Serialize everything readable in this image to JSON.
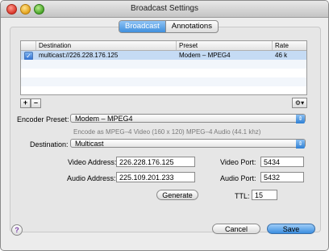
{
  "window": {
    "title": "Broadcast Settings"
  },
  "tabs": [
    {
      "label": "Broadcast",
      "active": true
    },
    {
      "label": "Annotations",
      "active": false
    }
  ],
  "table": {
    "columns": [
      "",
      "Destination",
      "Preset",
      "Rate"
    ],
    "rows": [
      {
        "checked": true,
        "destination": "multicast://226.228.176.125",
        "preset": "Modem – MPEG4",
        "rate": "46 k"
      }
    ]
  },
  "table_controls": {
    "add": "+",
    "remove": "–",
    "action": "⚙▾"
  },
  "encoder_preset": {
    "label": "Encoder Preset:",
    "value": "Modem – MPEG4",
    "description": "Encode as MPEG–4 Video (160 x 120) MPEG–4 Audio (44.1 khz)"
  },
  "destination": {
    "label": "Destination:",
    "value": "Multicast"
  },
  "video_address": {
    "label": "Video Address:",
    "value": "226.228.176.125"
  },
  "audio_address": {
    "label": "Audio Address:",
    "value": "225.109.201.233"
  },
  "video_port": {
    "label": "Video Port:",
    "value": "5434"
  },
  "audio_port": {
    "label": "Audio Port:",
    "value": "5432"
  },
  "ttl": {
    "label": "TTL:",
    "value": "15"
  },
  "buttons": {
    "generate": "Generate",
    "cancel": "Cancel",
    "save": "Save",
    "help": "?"
  },
  "icons": {
    "popup_arrow": "⇕",
    "check": "✓"
  }
}
